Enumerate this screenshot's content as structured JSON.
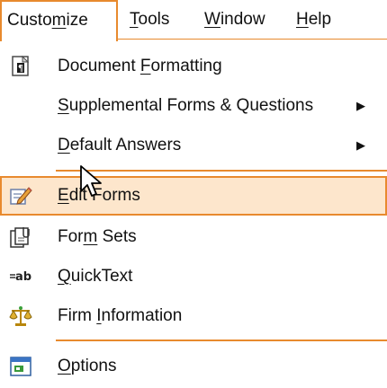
{
  "menubar": {
    "items": [
      {
        "label": "Customize",
        "active": true
      },
      {
        "label": "Tools"
      },
      {
        "label": "Window"
      },
      {
        "label": "Help"
      }
    ]
  },
  "menu": {
    "items": [
      {
        "label": "Document Formatting",
        "icon": "document-formatting-icon"
      },
      {
        "label": "Supplemental Forms & Questions",
        "submenu": true
      },
      {
        "label": "Default Answers",
        "submenu": true
      },
      {
        "label": "Edit Forms",
        "icon": "edit-pencil-icon",
        "highlighted": true
      },
      {
        "label": "Form Sets",
        "icon": "form-sets-icon"
      },
      {
        "label": "QuickText",
        "icon": "quicktext-ab-icon"
      },
      {
        "label": "Firm Information",
        "icon": "scales-icon"
      },
      {
        "label": "Options",
        "icon": "options-window-icon"
      }
    ],
    "submenu_arrow": "▶"
  },
  "colors": {
    "accent": "#e88a2e",
    "highlight_bg": "#fde6cc"
  }
}
